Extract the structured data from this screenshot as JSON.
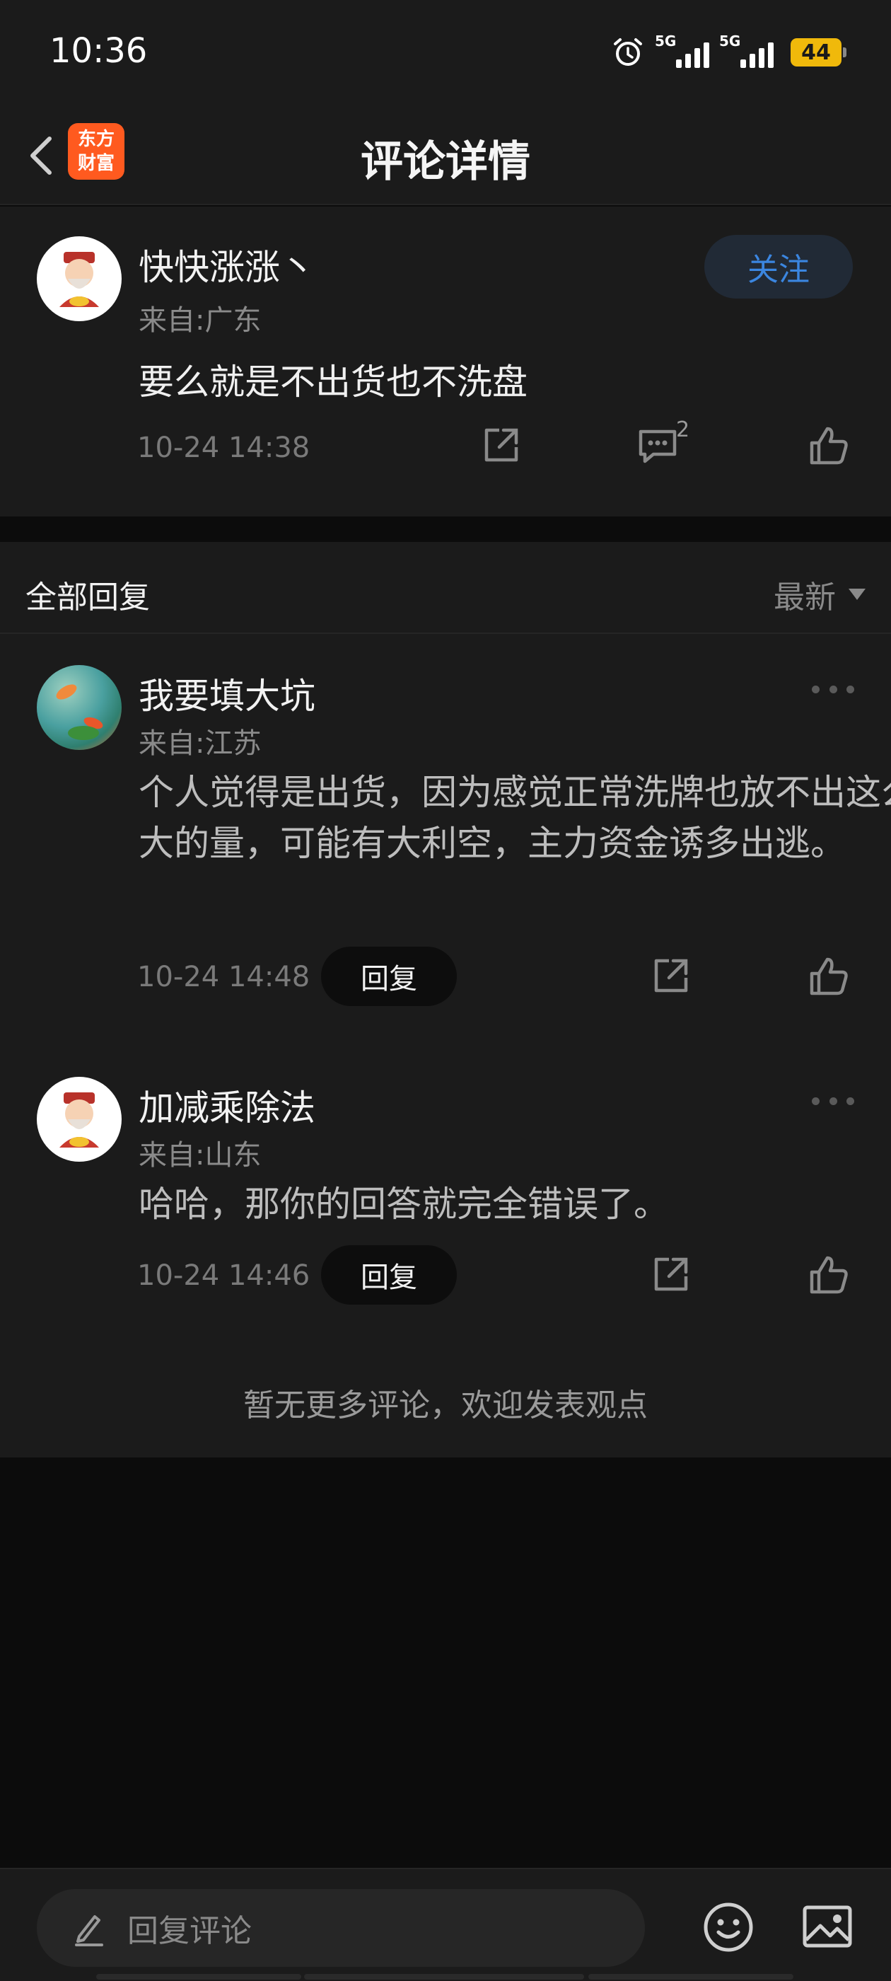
{
  "status_bar": {
    "time": "10:36",
    "network_1": "5G",
    "network_2": "5G",
    "battery": "44",
    "alarm_icon": "alarm-clock-icon",
    "battery_color": "#f0b90b"
  },
  "header": {
    "title": "评论详情",
    "back_icon": "chevron-left-icon",
    "logo_line1": "东方",
    "logo_line2": "财富",
    "logo_color": "#ff5a1f"
  },
  "main_comment": {
    "username": "快快涨涨丶",
    "location": "来自:广东",
    "text": "要么就是不出货也不洗盘",
    "time": "10-24 14:38",
    "follow_label": "关注",
    "reply_count": "2",
    "follow_color": "#3b86e0"
  },
  "replies": {
    "title": "全部回复",
    "sort_label": "最新",
    "items": [
      {
        "username": "我要填大坑",
        "location": "来自:江苏",
        "text": "个人觉得是出货，因为感觉正常洗牌也放不出这么大的量，可能有大利空，主力资金诱多出逃。",
        "time": "10-24 14:48",
        "reply_label": "回复"
      },
      {
        "username": "加减乘除法",
        "location": "来自:山东",
        "text": "哈哈，那你的回答就完全错误了。",
        "time": "10-24 14:46",
        "reply_label": "回复"
      }
    ],
    "no_more": "暂无更多评论，欢迎发表观点"
  },
  "bottom_bar": {
    "input_placeholder": "回复评论",
    "emoji_icon": "emoji-smile-icon",
    "image_icon": "image-icon",
    "pencil_icon": "pencil-icon"
  }
}
